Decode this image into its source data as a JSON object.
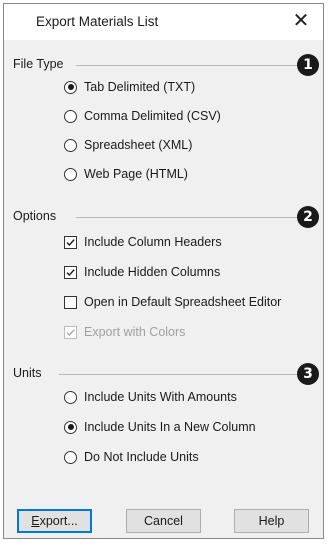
{
  "dialog": {
    "title": "Export Materials List",
    "close_glyph": "✕"
  },
  "file_type": {
    "legend": "File Type",
    "badge": "1",
    "options": [
      {
        "label": "Tab Delimited (TXT)",
        "selected": true
      },
      {
        "label": "Comma Delimited (CSV)",
        "selected": false
      },
      {
        "label": "Spreadsheet (XML)",
        "selected": false
      },
      {
        "label": "Web Page (HTML)",
        "selected": false
      }
    ]
  },
  "options": {
    "legend": "Options",
    "badge": "2",
    "items": [
      {
        "label": "Include Column Headers",
        "checked": true,
        "enabled": true
      },
      {
        "label": "Include Hidden Columns",
        "checked": true,
        "enabled": true
      },
      {
        "label": "Open in Default Spreadsheet Editor",
        "checked": false,
        "enabled": true
      },
      {
        "label": "Export with Colors",
        "checked": true,
        "enabled": false
      }
    ]
  },
  "units": {
    "legend": "Units",
    "badge": "3",
    "options": [
      {
        "label": "Include Units With Amounts",
        "selected": false
      },
      {
        "label": "Include Units In a New Column",
        "selected": true
      },
      {
        "label": "Do Not Include Units",
        "selected": false
      }
    ]
  },
  "buttons": {
    "export_accel": "E",
    "export_rest": "xport...",
    "cancel": "Cancel",
    "help": "Help"
  }
}
